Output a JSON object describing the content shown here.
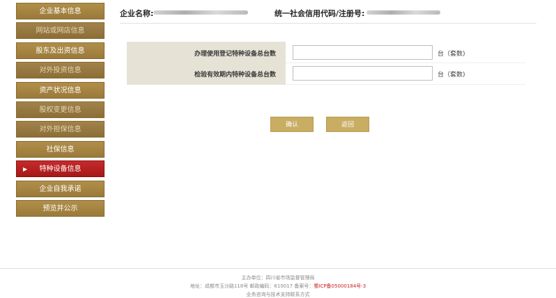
{
  "sidebar": {
    "items": [
      {
        "label": "企业基本信息"
      },
      {
        "label": "网站或网店信息"
      },
      {
        "label": "股东及出资信息"
      },
      {
        "label": "对外投资信息"
      },
      {
        "label": "资产状况信息"
      },
      {
        "label": "股权变更信息"
      },
      {
        "label": "对外担保信息"
      },
      {
        "label": "社保信息"
      },
      {
        "label": "特种设备信息",
        "active": true
      },
      {
        "label": "企业自我承诺"
      },
      {
        "label": "预览并公示"
      }
    ],
    "active_marker": "▶"
  },
  "header": {
    "company_name_label": "企业名称:",
    "credit_code_label": "统一社会信用代码/注册号:"
  },
  "form": {
    "rows": [
      {
        "label": "办理使用登记特种设备总台数",
        "value": "",
        "unit": "台（套数)"
      },
      {
        "label": "检验有效期内特种设备总台数",
        "value": "",
        "unit": "台（套数)"
      }
    ]
  },
  "buttons": {
    "confirm": "确认",
    "back": "返回"
  },
  "footer": {
    "sponsor": "主办单位：四川省市场监督管理局",
    "address": "地址：成都市玉沙路118号  邮政编码：610017  备案号：",
    "icp": "蜀ICP备05000184号-3",
    "support": "业务咨询与技术支持联系方式"
  }
}
